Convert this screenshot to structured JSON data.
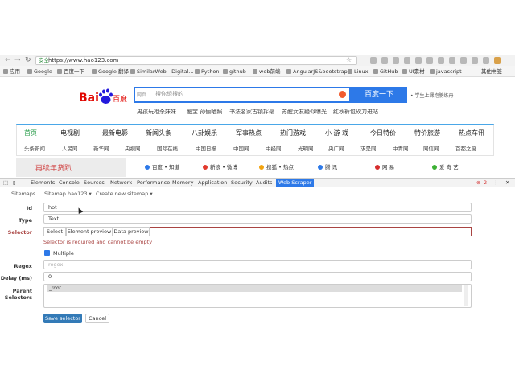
{
  "browser": {
    "secure": "安全",
    "url": "https://www.hao123.com"
  },
  "bookmarks": [
    "应用",
    "Google",
    "百度一下",
    "Google 翻译",
    "SimilarWeb - Digital...",
    "Python",
    "github",
    "web前端",
    "AngularJS&bootstrap",
    "Linux",
    "GitHub",
    "UI素材",
    "javascript",
    "其他书签"
  ],
  "baidu": {
    "logo_text": "Bai",
    "logo_cn": "百度",
    "search_tab": "网页",
    "search_placeholder": "搜你想搜的",
    "search_button": "百度一下",
    "side_link": "• 学生上课泡膀练丹"
  },
  "hot_searches": [
    "男孩玩枪杀妹妹",
    "醒宝 孙俪晒照",
    "书法名家古镇挥毫",
    "苏醒女友疑似曝光",
    "红秋裤包砍刀进站"
  ],
  "nav_row1": [
    "首页",
    "电视剧",
    "最新电影",
    "新闻头条",
    "八卦娱乐",
    "军事热点",
    "热门游戏",
    "小 游 戏",
    "今日特价",
    "特价旅游",
    "热点车讯"
  ],
  "nav_row2": [
    "头条新闻",
    "人民网",
    "新华网",
    "央视网",
    "国际在线",
    "中国日报",
    "中国网",
    "中经网",
    "光明网",
    "央广网",
    "求是网",
    "中青网",
    "网信网",
    "首都之窗"
  ],
  "promo": "再续年货趴",
  "sites": [
    "百度 • 知道",
    "新浪 • 微博",
    "搜狐 • 热点",
    "腾 讯",
    "网 易",
    "爱 奇 艺"
  ],
  "devtools": {
    "tabs": [
      "Elements",
      "Console",
      "Sources",
      "Network",
      "Performance",
      "Memory",
      "Application",
      "Security",
      "Audits",
      "Web Scraper"
    ],
    "error_count": "2"
  },
  "scraper": {
    "breadcrumbs": [
      "Sitemaps",
      "Sitemap hao123 ▾",
      "Create new sitemap ▾"
    ],
    "id_label": "Id",
    "id_value": "hot",
    "type_label": "Type",
    "type_value": "Text",
    "selector_label": "Selector",
    "select_btn": "Select",
    "element_preview_btn": "Element preview",
    "data_preview_btn": "Data preview",
    "selector_error": "Selector is required and cannot be empty",
    "multiple_label": "Multiple",
    "regex_label": "Regex",
    "regex_placeholder": "regex",
    "delay_label": "Delay (ms)",
    "delay_value": "0",
    "parent_label": "Parent Selectors",
    "parent_value": "_root",
    "save_btn": "Save selector",
    "cancel_btn": "Cancel"
  }
}
